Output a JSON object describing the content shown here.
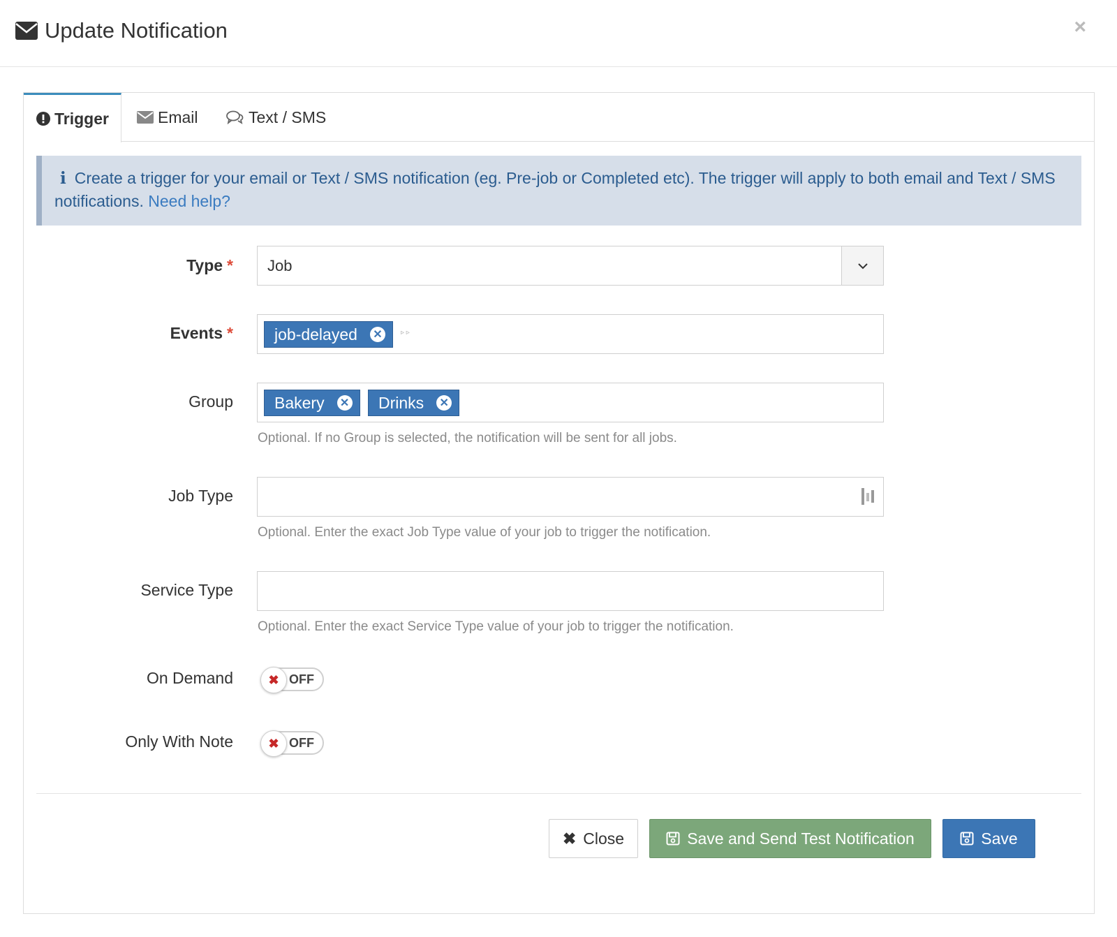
{
  "modal": {
    "title": "Update Notification",
    "close_glyph": "×",
    "title_icon": "envelope-icon"
  },
  "tabs": [
    {
      "label": "Trigger",
      "icon": "exclamation-circle-icon",
      "active": true
    },
    {
      "label": "Email",
      "icon": "envelope-icon",
      "active": false
    },
    {
      "label": "Text / SMS",
      "icon": "chat-bubbles-icon",
      "active": false
    }
  ],
  "callout": {
    "text": "Create a trigger for your email or Text / SMS notification (eg. Pre-job or Completed etc). The trigger will apply to both email and Text / SMS notifications.",
    "link": "Need help?"
  },
  "form": {
    "type": {
      "label": "Type",
      "required_mark": "*",
      "value": "Job"
    },
    "events": {
      "label": "Events",
      "required_mark": "*",
      "tags": [
        "job-delayed"
      ]
    },
    "group": {
      "label": "Group",
      "tags": [
        "Bakery",
        "Drinks"
      ],
      "help": "Optional. If no Group is selected, the notification will be sent for all jobs."
    },
    "job_type": {
      "label": "Job Type",
      "value": "",
      "help": "Optional. Enter the exact Job Type value of your job to trigger the notification."
    },
    "service_type": {
      "label": "Service Type",
      "value": "",
      "help": "Optional. Enter the exact Service Type value of your job to trigger the notification."
    },
    "on_demand": {
      "label": "On Demand",
      "state": "OFF"
    },
    "only_with_note": {
      "label": "Only With Note",
      "state": "OFF"
    }
  },
  "buttons": {
    "close": "Close",
    "save_test": "Save and Send Test Notification",
    "save": "Save"
  },
  "colors": {
    "primary": "#3c76b5",
    "success": "#7ca77a",
    "callout_bg": "#d6dee9",
    "required": "#dd4b39"
  }
}
